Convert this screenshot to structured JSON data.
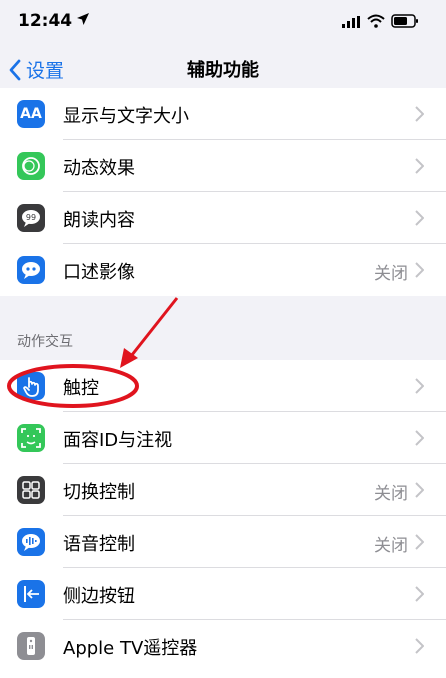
{
  "status": {
    "time": "12:44"
  },
  "nav": {
    "back_label": "设置",
    "title": "辅助功能"
  },
  "vision_rows": [
    {
      "label": "显示与文字大小",
      "value": "",
      "icon": "text-size-icon",
      "icon_text": "AA",
      "color": "#1a73e8"
    },
    {
      "label": "动态效果",
      "value": "",
      "icon": "motion-icon",
      "color": "#34c759"
    },
    {
      "label": "朗读内容",
      "value": "",
      "icon": "speech-bubble-icon",
      "color": "#3a3a3c"
    },
    {
      "label": "口述影像",
      "value": "关闭",
      "icon": "audio-description-icon",
      "color": "#1a73e8"
    }
  ],
  "section_header": "动作交互",
  "interaction_rows": [
    {
      "label": "触控",
      "value": "",
      "icon": "hand-touch-icon",
      "color": "#1a73e8"
    },
    {
      "label": "面容ID与注视",
      "value": "",
      "icon": "face-id-icon",
      "color": "#34c759"
    },
    {
      "label": "切换控制",
      "value": "关闭",
      "icon": "switch-control-icon",
      "color": "#3a3a3c"
    },
    {
      "label": "语音控制",
      "value": "关闭",
      "icon": "voice-control-icon",
      "color": "#1a73e8"
    },
    {
      "label": "侧边按钮",
      "value": "",
      "icon": "side-button-icon",
      "color": "#1a73e8"
    },
    {
      "label": "Apple TV遥控器",
      "value": "",
      "icon": "remote-icon",
      "color": "#8e8e93"
    }
  ],
  "colors": {
    "accent": "#1a73e8",
    "annotation": "#e0141e"
  }
}
